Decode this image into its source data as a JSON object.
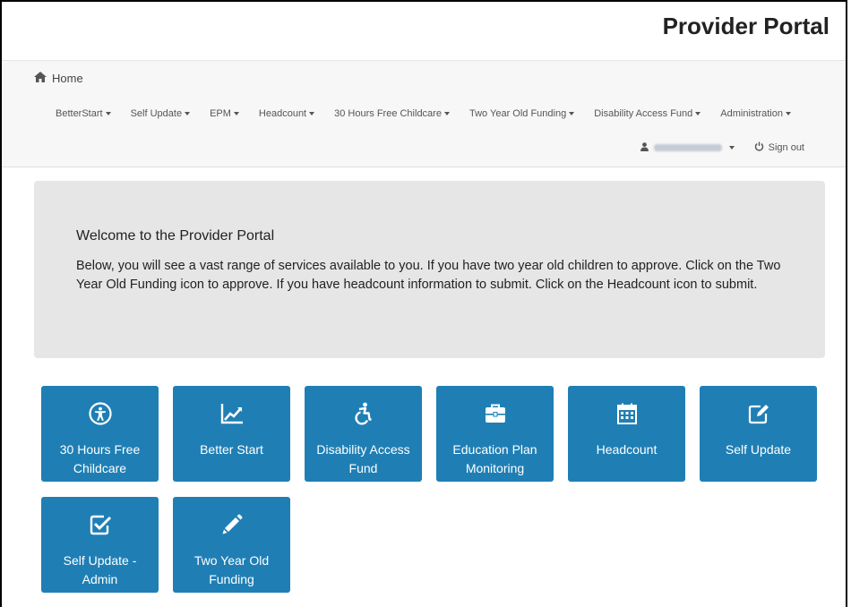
{
  "header": {
    "brand": "Provider Portal"
  },
  "nav": {
    "home": "Home",
    "menu": [
      {
        "label": "BetterStart"
      },
      {
        "label": "Self Update"
      },
      {
        "label": "EPM"
      },
      {
        "label": "Headcount"
      },
      {
        "label": "30 Hours Free Childcare"
      },
      {
        "label": "Two Year Old Funding"
      },
      {
        "label": "Disability Access Fund"
      },
      {
        "label": "Administration"
      }
    ],
    "signout": "Sign out"
  },
  "welcome": {
    "title": "Welcome to the Provider Portal",
    "body": "Below, you will see a vast range of services available to you. If you have two year old children to approve. Click on the Two Year Old Funding icon to approve. If you have headcount information to submit. Click on the Headcount icon to submit."
  },
  "tiles": [
    {
      "label": "30 Hours Free Childcare",
      "icon": "accessibility-icon"
    },
    {
      "label": "Better Start",
      "icon": "line-chart-icon"
    },
    {
      "label": "Disability Access Fund",
      "icon": "wheelchair-icon"
    },
    {
      "label": "Education Plan Monitoring",
      "icon": "briefcase-icon"
    },
    {
      "label": "Headcount",
      "icon": "calendar-icon"
    },
    {
      "label": "Self Update",
      "icon": "edit-icon"
    },
    {
      "label": "Self Update - Admin",
      "icon": "check-square-icon"
    },
    {
      "label": "Two Year Old Funding",
      "icon": "pencil-icon"
    }
  ],
  "colors": {
    "tile": "#1f7fb5",
    "jumbotron": "#e6e6e6",
    "navbar": "#f7f7f7"
  }
}
